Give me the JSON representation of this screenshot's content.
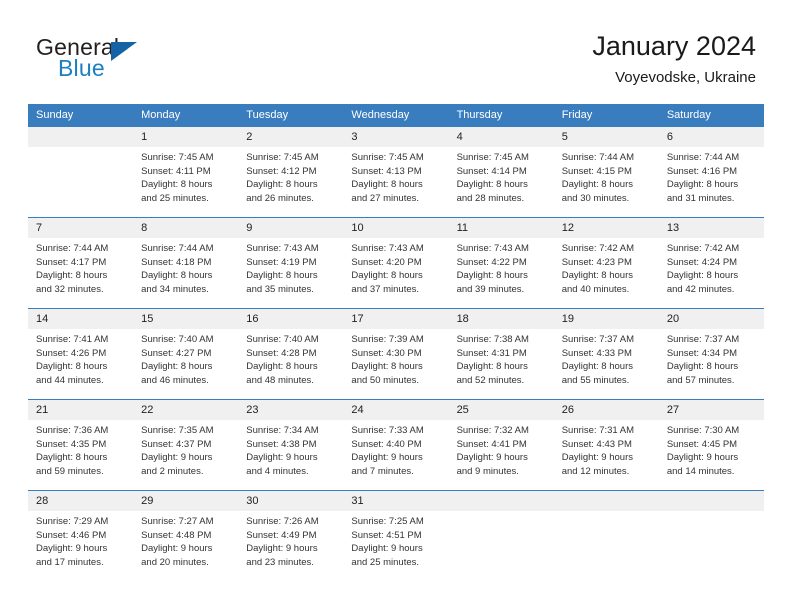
{
  "brand": {
    "name_top": "General",
    "name_bottom": "Blue",
    "triangle_color": "#1464a5",
    "blue_color": "#1c7fc4"
  },
  "header": {
    "title": "January 2024",
    "subtitle": "Voyevodske, Ukraine"
  },
  "theme": {
    "header_blue": "#3a7dbf",
    "daynum_band": "#f0f0f0",
    "text": "#333333"
  },
  "weekday_headers": [
    "Sunday",
    "Monday",
    "Tuesday",
    "Wednesday",
    "Thursday",
    "Friday",
    "Saturday"
  ],
  "weeks": [
    [
      {
        "day": "",
        "sunrise": "",
        "sunset": "",
        "daylight1": "",
        "daylight2": "",
        "empty": true
      },
      {
        "day": "1",
        "sunrise": "Sunrise: 7:45 AM",
        "sunset": "Sunset: 4:11 PM",
        "daylight1": "Daylight: 8 hours",
        "daylight2": "and 25 minutes."
      },
      {
        "day": "2",
        "sunrise": "Sunrise: 7:45 AM",
        "sunset": "Sunset: 4:12 PM",
        "daylight1": "Daylight: 8 hours",
        "daylight2": "and 26 minutes."
      },
      {
        "day": "3",
        "sunrise": "Sunrise: 7:45 AM",
        "sunset": "Sunset: 4:13 PM",
        "daylight1": "Daylight: 8 hours",
        "daylight2": "and 27 minutes."
      },
      {
        "day": "4",
        "sunrise": "Sunrise: 7:45 AM",
        "sunset": "Sunset: 4:14 PM",
        "daylight1": "Daylight: 8 hours",
        "daylight2": "and 28 minutes."
      },
      {
        "day": "5",
        "sunrise": "Sunrise: 7:44 AM",
        "sunset": "Sunset: 4:15 PM",
        "daylight1": "Daylight: 8 hours",
        "daylight2": "and 30 minutes."
      },
      {
        "day": "6",
        "sunrise": "Sunrise: 7:44 AM",
        "sunset": "Sunset: 4:16 PM",
        "daylight1": "Daylight: 8 hours",
        "daylight2": "and 31 minutes."
      }
    ],
    [
      {
        "day": "7",
        "sunrise": "Sunrise: 7:44 AM",
        "sunset": "Sunset: 4:17 PM",
        "daylight1": "Daylight: 8 hours",
        "daylight2": "and 32 minutes."
      },
      {
        "day": "8",
        "sunrise": "Sunrise: 7:44 AM",
        "sunset": "Sunset: 4:18 PM",
        "daylight1": "Daylight: 8 hours",
        "daylight2": "and 34 minutes."
      },
      {
        "day": "9",
        "sunrise": "Sunrise: 7:43 AM",
        "sunset": "Sunset: 4:19 PM",
        "daylight1": "Daylight: 8 hours",
        "daylight2": "and 35 minutes."
      },
      {
        "day": "10",
        "sunrise": "Sunrise: 7:43 AM",
        "sunset": "Sunset: 4:20 PM",
        "daylight1": "Daylight: 8 hours",
        "daylight2": "and 37 minutes."
      },
      {
        "day": "11",
        "sunrise": "Sunrise: 7:43 AM",
        "sunset": "Sunset: 4:22 PM",
        "daylight1": "Daylight: 8 hours",
        "daylight2": "and 39 minutes."
      },
      {
        "day": "12",
        "sunrise": "Sunrise: 7:42 AM",
        "sunset": "Sunset: 4:23 PM",
        "daylight1": "Daylight: 8 hours",
        "daylight2": "and 40 minutes."
      },
      {
        "day": "13",
        "sunrise": "Sunrise: 7:42 AM",
        "sunset": "Sunset: 4:24 PM",
        "daylight1": "Daylight: 8 hours",
        "daylight2": "and 42 minutes."
      }
    ],
    [
      {
        "day": "14",
        "sunrise": "Sunrise: 7:41 AM",
        "sunset": "Sunset: 4:26 PM",
        "daylight1": "Daylight: 8 hours",
        "daylight2": "and 44 minutes."
      },
      {
        "day": "15",
        "sunrise": "Sunrise: 7:40 AM",
        "sunset": "Sunset: 4:27 PM",
        "daylight1": "Daylight: 8 hours",
        "daylight2": "and 46 minutes."
      },
      {
        "day": "16",
        "sunrise": "Sunrise: 7:40 AM",
        "sunset": "Sunset: 4:28 PM",
        "daylight1": "Daylight: 8 hours",
        "daylight2": "and 48 minutes."
      },
      {
        "day": "17",
        "sunrise": "Sunrise: 7:39 AM",
        "sunset": "Sunset: 4:30 PM",
        "daylight1": "Daylight: 8 hours",
        "daylight2": "and 50 minutes."
      },
      {
        "day": "18",
        "sunrise": "Sunrise: 7:38 AM",
        "sunset": "Sunset: 4:31 PM",
        "daylight1": "Daylight: 8 hours",
        "daylight2": "and 52 minutes."
      },
      {
        "day": "19",
        "sunrise": "Sunrise: 7:37 AM",
        "sunset": "Sunset: 4:33 PM",
        "daylight1": "Daylight: 8 hours",
        "daylight2": "and 55 minutes."
      },
      {
        "day": "20",
        "sunrise": "Sunrise: 7:37 AM",
        "sunset": "Sunset: 4:34 PM",
        "daylight1": "Daylight: 8 hours",
        "daylight2": "and 57 minutes."
      }
    ],
    [
      {
        "day": "21",
        "sunrise": "Sunrise: 7:36 AM",
        "sunset": "Sunset: 4:35 PM",
        "daylight1": "Daylight: 8 hours",
        "daylight2": "and 59 minutes."
      },
      {
        "day": "22",
        "sunrise": "Sunrise: 7:35 AM",
        "sunset": "Sunset: 4:37 PM",
        "daylight1": "Daylight: 9 hours",
        "daylight2": "and 2 minutes."
      },
      {
        "day": "23",
        "sunrise": "Sunrise: 7:34 AM",
        "sunset": "Sunset: 4:38 PM",
        "daylight1": "Daylight: 9 hours",
        "daylight2": "and 4 minutes."
      },
      {
        "day": "24",
        "sunrise": "Sunrise: 7:33 AM",
        "sunset": "Sunset: 4:40 PM",
        "daylight1": "Daylight: 9 hours",
        "daylight2": "and 7 minutes."
      },
      {
        "day": "25",
        "sunrise": "Sunrise: 7:32 AM",
        "sunset": "Sunset: 4:41 PM",
        "daylight1": "Daylight: 9 hours",
        "daylight2": "and 9 minutes."
      },
      {
        "day": "26",
        "sunrise": "Sunrise: 7:31 AM",
        "sunset": "Sunset: 4:43 PM",
        "daylight1": "Daylight: 9 hours",
        "daylight2": "and 12 minutes."
      },
      {
        "day": "27",
        "sunrise": "Sunrise: 7:30 AM",
        "sunset": "Sunset: 4:45 PM",
        "daylight1": "Daylight: 9 hours",
        "daylight2": "and 14 minutes."
      }
    ],
    [
      {
        "day": "28",
        "sunrise": "Sunrise: 7:29 AM",
        "sunset": "Sunset: 4:46 PM",
        "daylight1": "Daylight: 9 hours",
        "daylight2": "and 17 minutes."
      },
      {
        "day": "29",
        "sunrise": "Sunrise: 7:27 AM",
        "sunset": "Sunset: 4:48 PM",
        "daylight1": "Daylight: 9 hours",
        "daylight2": "and 20 minutes."
      },
      {
        "day": "30",
        "sunrise": "Sunrise: 7:26 AM",
        "sunset": "Sunset: 4:49 PM",
        "daylight1": "Daylight: 9 hours",
        "daylight2": "and 23 minutes."
      },
      {
        "day": "31",
        "sunrise": "Sunrise: 7:25 AM",
        "sunset": "Sunset: 4:51 PM",
        "daylight1": "Daylight: 9 hours",
        "daylight2": "and 25 minutes."
      },
      {
        "day": "",
        "sunrise": "",
        "sunset": "",
        "daylight1": "",
        "daylight2": "",
        "empty": true
      },
      {
        "day": "",
        "sunrise": "",
        "sunset": "",
        "daylight1": "",
        "daylight2": "",
        "empty": true
      },
      {
        "day": "",
        "sunrise": "",
        "sunset": "",
        "daylight1": "",
        "daylight2": "",
        "empty": true
      }
    ]
  ]
}
